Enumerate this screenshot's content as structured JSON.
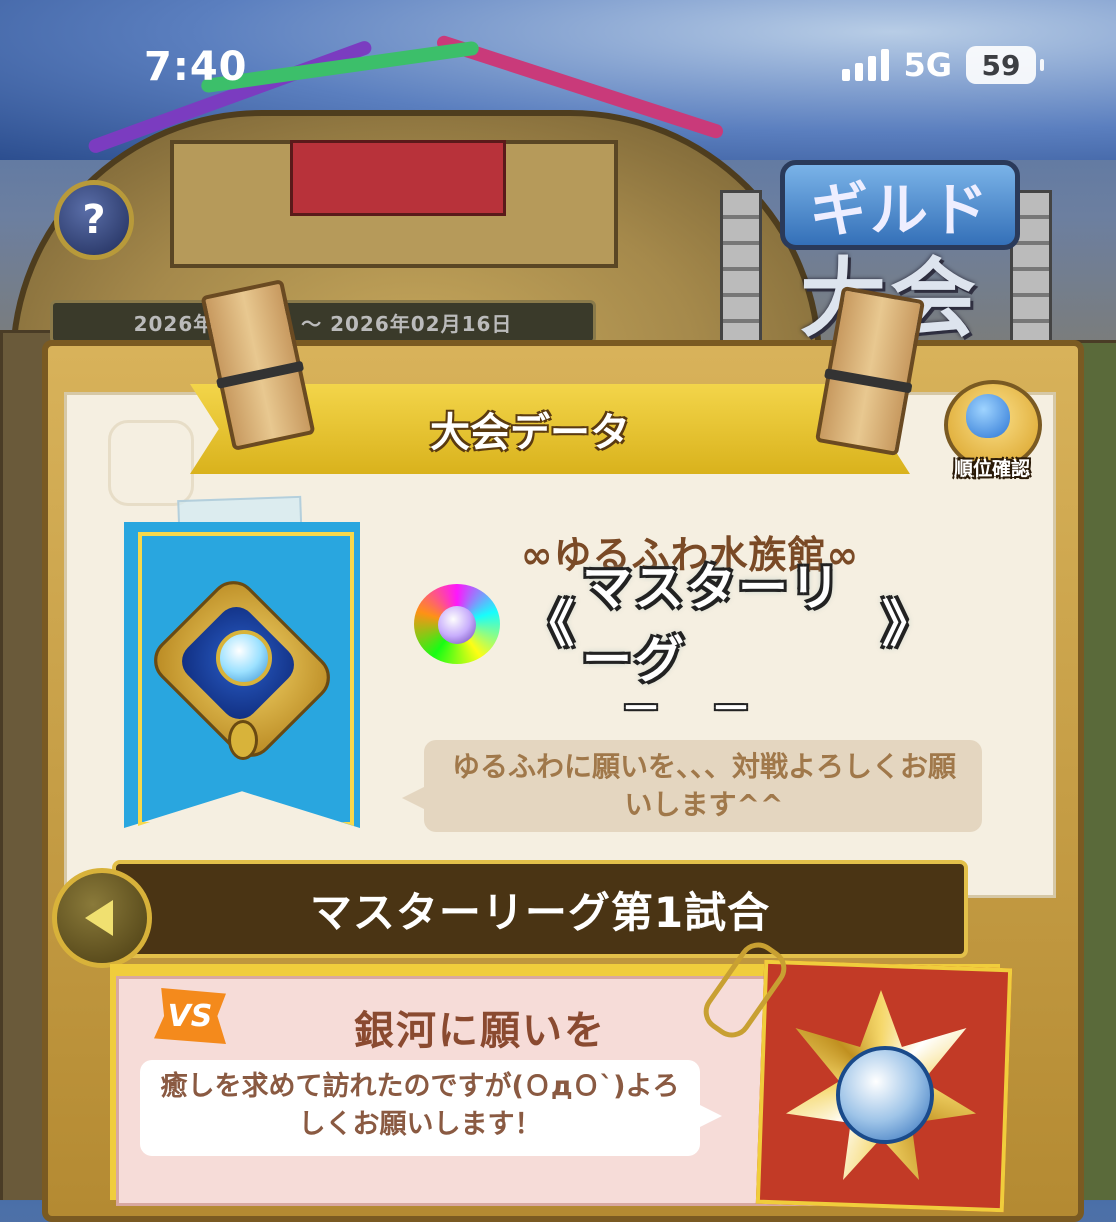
{
  "status_bar": {
    "time": "7:40",
    "network": "5G",
    "battery": "59"
  },
  "header": {
    "help_button_label": "?",
    "logo_line1": "ギルド",
    "logo_line2": "大会",
    "date_range": "2026年0_月_日 ～ 2026年02月16日"
  },
  "panel": {
    "ribbon_title": "大会データ",
    "rank_button_label": "順位確認",
    "guild_name": "∞ゆるふわ水族館∞",
    "league_name": "マスターリーグ",
    "rank_display": "－ － －",
    "guild_message": "ゆるふわに願いを、、、対戦よろしくお願いします^^"
  },
  "match": {
    "title": "マスターリーグ第1試合",
    "vs_label": "VS",
    "opponent_name": "銀河に願いを",
    "opponent_message": "癒しを求めて訪れたのですが(ＯдＯ`)よろしくお願いします！"
  },
  "colors": {
    "ribbon": "#f3d54a",
    "banner": "#29a6df",
    "panel_gold": "#d8b25a",
    "crest_card": "#c23a26"
  },
  "icons": {
    "help": "question-icon",
    "back": "triangle-left-icon",
    "signal": "signal-bars-icon",
    "battery": "battery-icon"
  }
}
